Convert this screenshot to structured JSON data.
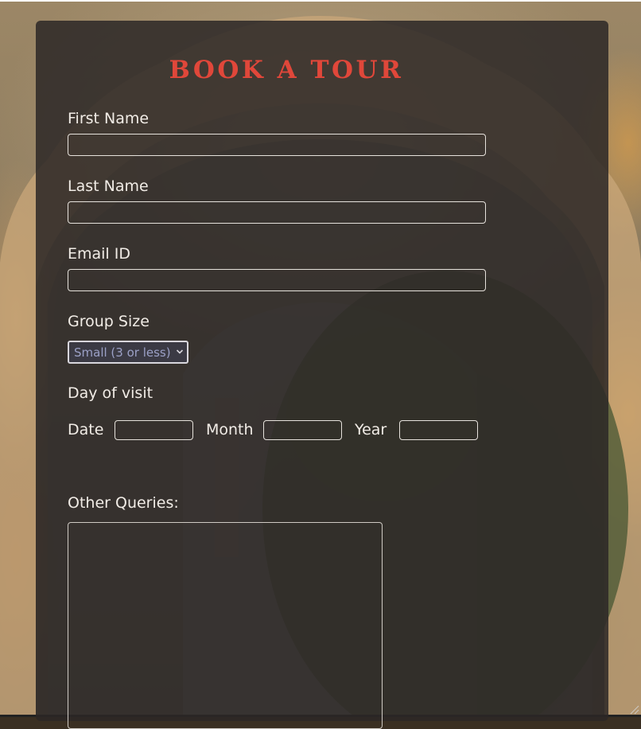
{
  "form": {
    "title": "BOOK A TOUR",
    "fields": {
      "first_name": {
        "label": "First Name",
        "value": ""
      },
      "last_name": {
        "label": "Last Name",
        "value": ""
      },
      "email": {
        "label": "Email ID",
        "value": ""
      },
      "group_size": {
        "label": "Group Size",
        "selected": "Small (3 or less)"
      },
      "day_of_visit": {
        "label": "Day of visit",
        "date_label": "Date",
        "month_label": "Month",
        "year_label": "Year",
        "date_value": "",
        "month_value": "",
        "year_value": ""
      },
      "other_queries": {
        "label": "Other Queries:",
        "value": ""
      }
    }
  },
  "colors": {
    "title": "#e0473a",
    "panel": "#2c2826",
    "label_text": "#f1ece6",
    "input_border": "#e6e2dc",
    "select_text": "#9ba0c6"
  },
  "icons": {
    "select_arrow": "chevron-down-icon",
    "resize_grip": "resize-grip-icon"
  }
}
